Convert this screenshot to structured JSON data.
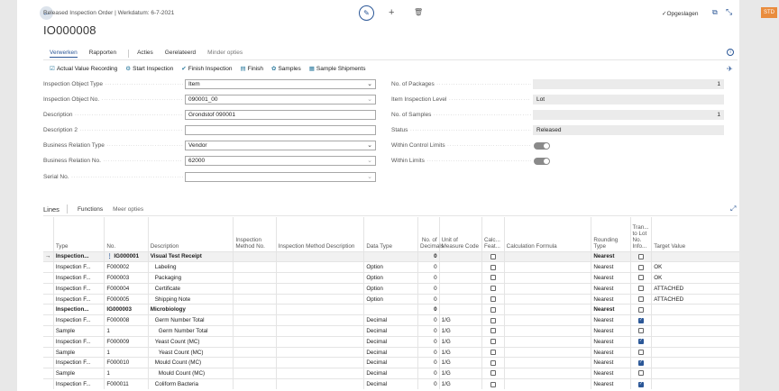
{
  "header": {
    "breadcrumb": "Released Inspection Order | Werkdatum: 6-7-2021",
    "title": "IO000008",
    "saved_label": "Opgeslagen",
    "badge": "STD"
  },
  "menu": {
    "items": [
      "Verwerken",
      "Rapporten",
      "Acties",
      "Gerelateerd",
      "Minder opties"
    ]
  },
  "actions": {
    "items": [
      "Actual Value Recording",
      "Start Inspection",
      "Finish Inspection",
      "Finish",
      "Samples",
      "Sample Shipments"
    ]
  },
  "form": {
    "left": [
      {
        "label": "Inspection Object Type",
        "value": "Item"
      },
      {
        "label": "Inspection Object No.",
        "value": "090001_00"
      },
      {
        "label": "Description",
        "value": "Grondstof 090001"
      },
      {
        "label": "Description 2",
        "value": ""
      },
      {
        "label": "Business Relation Type",
        "value": "Vendor"
      },
      {
        "label": "Business Relation No.",
        "value": "62000"
      },
      {
        "label": "Serial No.",
        "value": ""
      }
    ],
    "right": [
      {
        "label": "No. of Packages",
        "value": "1"
      },
      {
        "label": "Item Inspection Level",
        "value": "Lot"
      },
      {
        "label": "No. of Samples",
        "value": "1"
      },
      {
        "label": "Status",
        "value": "Released"
      },
      {
        "label": "Within Control Limits",
        "value": "on"
      },
      {
        "label": "Within Limits",
        "value": "on"
      }
    ]
  },
  "lines": {
    "title": "Lines",
    "menu": [
      "Functions",
      "Meer opties"
    ],
    "columns": [
      "Type",
      "No.",
      "Description",
      "Inspection Method No.",
      "Inspection Method Description",
      "Data Type",
      "No. of Decimals",
      "Unit of Measure Code",
      "Calc... Feat...",
      "Calculation Formula",
      "Rounding Type",
      "Tran... to Lot No. Info...",
      "Target Value"
    ],
    "rows": [
      {
        "type": "Inspection...",
        "no": "IG000001",
        "desc": "Visual Test Receipt",
        "dtype": "",
        "dec": "0",
        "uom": "",
        "rnd": "Nearest",
        "tran": false,
        "target": "",
        "bold": true,
        "sel": true
      },
      {
        "type": "Inspection F...",
        "no": "F000002",
        "desc": "Labeling",
        "dtype": "Option",
        "dec": "0",
        "uom": "",
        "rnd": "Nearest",
        "tran": false,
        "target": "OK",
        "bold": false,
        "sel": false
      },
      {
        "type": "Inspection F...",
        "no": "F000003",
        "desc": "Packaging",
        "dtype": "Option",
        "dec": "0",
        "uom": "",
        "rnd": "Nearest",
        "tran": false,
        "target": "OK",
        "bold": false,
        "sel": false
      },
      {
        "type": "Inspection F...",
        "no": "F000004",
        "desc": "Certificate",
        "dtype": "Option",
        "dec": "0",
        "uom": "",
        "rnd": "Nearest",
        "tran": false,
        "target": "ATTACHED",
        "bold": false,
        "sel": false
      },
      {
        "type": "Inspection F...",
        "no": "F000005",
        "desc": "Shipping Note",
        "dtype": "Option",
        "dec": "0",
        "uom": "",
        "rnd": "Nearest",
        "tran": false,
        "target": "ATTACHED",
        "bold": false,
        "sel": false
      },
      {
        "type": "Inspection...",
        "no": "IG000003",
        "desc": "Microbiology",
        "dtype": "",
        "dec": "0",
        "uom": "",
        "rnd": "Nearest",
        "tran": false,
        "target": "",
        "bold": true,
        "sel": false
      },
      {
        "type": "Inspection F...",
        "no": "F000008",
        "desc": "Germ Number Total",
        "dtype": "Decimal",
        "dec": "0",
        "uom": "1/G",
        "rnd": "Nearest",
        "tran": true,
        "target": "",
        "bold": false,
        "sel": false
      },
      {
        "type": "Sample",
        "no": "1",
        "desc": "Germ Number Total",
        "dtype": "Decimal",
        "dec": "0",
        "uom": "1/G",
        "rnd": "Nearest",
        "tran": false,
        "target": "",
        "bold": false,
        "sel": false
      },
      {
        "type": "Inspection F...",
        "no": "F000009",
        "desc": "Yeast Count (MC)",
        "dtype": "Decimal",
        "dec": "0",
        "uom": "1/G",
        "rnd": "Nearest",
        "tran": true,
        "target": "",
        "bold": false,
        "sel": false
      },
      {
        "type": "Sample",
        "no": "1",
        "desc": "Yeast Count (MC)",
        "dtype": "Decimal",
        "dec": "0",
        "uom": "1/G",
        "rnd": "Nearest",
        "tran": false,
        "target": "",
        "bold": false,
        "sel": false
      },
      {
        "type": "Inspection F...",
        "no": "F000010",
        "desc": "Mould Count (MC)",
        "dtype": "Decimal",
        "dec": "0",
        "uom": "1/G",
        "rnd": "Nearest",
        "tran": true,
        "target": "",
        "bold": false,
        "sel": false
      },
      {
        "type": "Sample",
        "no": "1",
        "desc": "Mould Count (MC)",
        "dtype": "Decimal",
        "dec": "0",
        "uom": "1/G",
        "rnd": "Nearest",
        "tran": false,
        "target": "",
        "bold": false,
        "sel": false
      },
      {
        "type": "Inspection F...",
        "no": "F000011",
        "desc": "Coliform Bacteria",
        "dtype": "Decimal",
        "dec": "0",
        "uom": "1/G",
        "rnd": "Nearest",
        "tran": true,
        "target": "",
        "bold": false,
        "sel": false
      }
    ]
  },
  "colors": {
    "accent": "#2b5797",
    "badge": "#e98c3d"
  }
}
